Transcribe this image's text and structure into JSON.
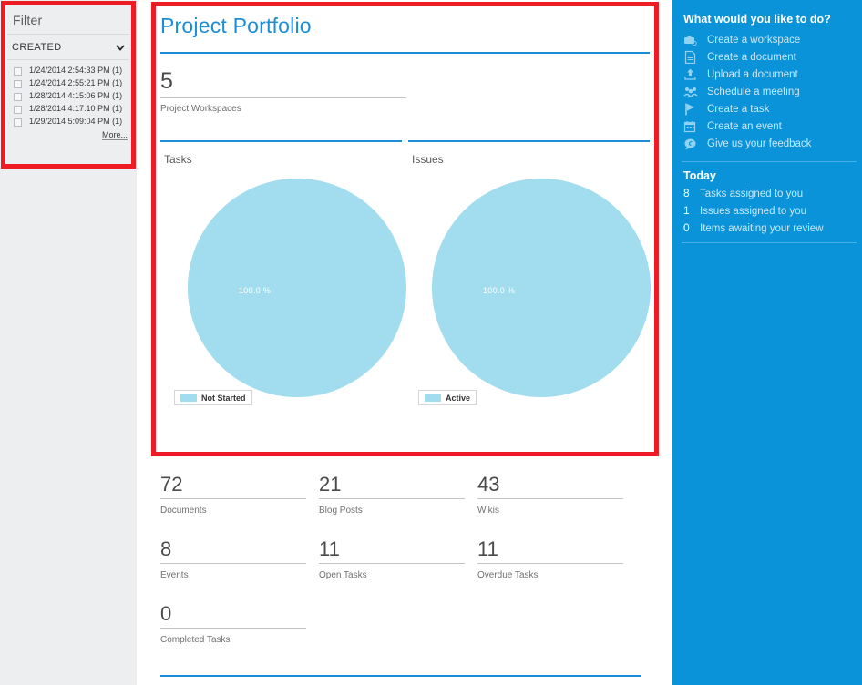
{
  "filter": {
    "title": "Filter",
    "selected_field": "CREATED",
    "dropdown_icon": "chevron-down-icon",
    "options": [
      {
        "label": "1/24/2014 2:54:33 PM (1)",
        "checked": false
      },
      {
        "label": "1/24/2014 2:55:21 PM (1)",
        "checked": false
      },
      {
        "label": "1/28/2014 4:15:06 PM (1)",
        "checked": false
      },
      {
        "label": "1/28/2014 4:17:10 PM (1)",
        "checked": false
      },
      {
        "label": "1/29/2014 5:09:04 PM (1)",
        "checked": false
      }
    ],
    "more_label": "More..."
  },
  "main": {
    "title": "Project Portfolio",
    "workspaces": {
      "value": "5",
      "label": "Project Workspaces"
    },
    "charts": [
      {
        "heading": "Tasks",
        "percent_label": "100.0 %",
        "legend": "Not Started"
      },
      {
        "heading": "Issues",
        "percent_label": "100.0 %",
        "legend": "Active"
      }
    ],
    "stats": [
      [
        {
          "value": "72",
          "label": "Documents"
        },
        {
          "value": "21",
          "label": "Blog Posts"
        },
        {
          "value": "43",
          "label": "Wikis"
        }
      ],
      [
        {
          "value": "8",
          "label": "Events"
        },
        {
          "value": "11",
          "label": "Open Tasks"
        },
        {
          "value": "11",
          "label": "Overdue Tasks"
        }
      ],
      [
        {
          "value": "0",
          "label": "Completed Tasks"
        }
      ]
    ]
  },
  "sidebar": {
    "actions_heading": "What would you like to do?",
    "actions": [
      {
        "label": "Create a workspace",
        "icon": "briefcase-icon"
      },
      {
        "label": "Create a document",
        "icon": "document-icon"
      },
      {
        "label": "Upload a document",
        "icon": "upload-icon"
      },
      {
        "label": "Schedule a meeting",
        "icon": "people-icon"
      },
      {
        "label": "Create a task",
        "icon": "flag-icon"
      },
      {
        "label": "Create an event",
        "icon": "calendar-icon"
      },
      {
        "label": "Give us your feedback",
        "icon": "speech-bubble-icon"
      }
    ],
    "today_heading": "Today",
    "today": [
      {
        "count": "8",
        "label": "Tasks assigned to you"
      },
      {
        "count": "1",
        "label": "Issues assigned to you"
      },
      {
        "count": "0",
        "label": "Items awaiting your review"
      }
    ]
  },
  "chart_data": [
    {
      "type": "pie",
      "title": "Tasks",
      "categories": [
        "Not Started"
      ],
      "values": [
        100.0
      ],
      "value_labels": [
        "100.0 %"
      ],
      "colors": [
        "#a2dcef"
      ],
      "legend_position": "bottom-left"
    },
    {
      "type": "pie",
      "title": "Issues",
      "categories": [
        "Active"
      ],
      "values": [
        100.0
      ],
      "value_labels": [
        "100.0 %"
      ],
      "colors": [
        "#a2dcef"
      ],
      "legend_position": "bottom-left"
    }
  ],
  "colors": {
    "accent_blue": "#1c8ed6",
    "sidebar_blue": "#0a93d8",
    "pie_fill": "#a2dcef",
    "highlight_red": "#ed1c24",
    "panel_gray": "#edeef0"
  }
}
